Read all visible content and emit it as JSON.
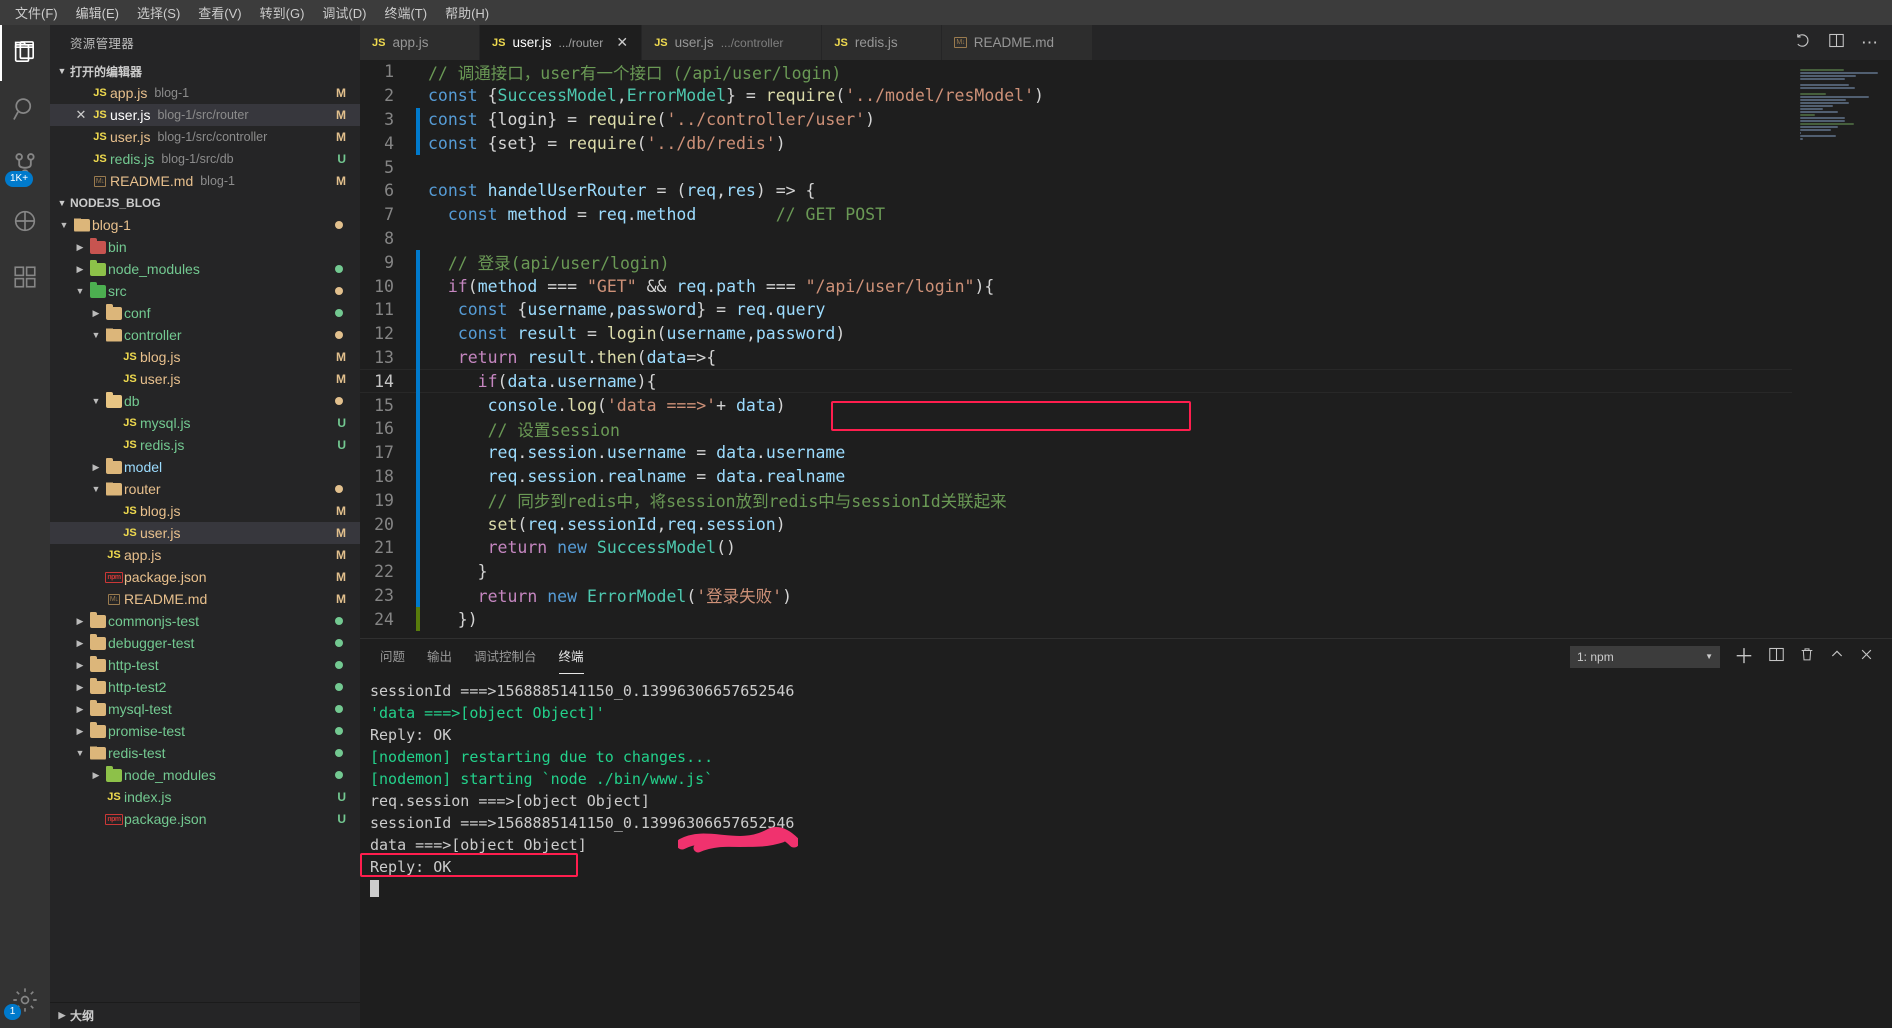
{
  "menubar": {
    "items": [
      "文件(F)",
      "编辑(E)",
      "选择(S)",
      "查看(V)",
      "转到(G)",
      "调试(D)",
      "终端(T)",
      "帮助(H)"
    ]
  },
  "activitybar": {
    "items": [
      {
        "name": "explorer-icon",
        "label": "资源管理器",
        "active": true
      },
      {
        "name": "search-icon",
        "label": "搜索",
        "active": false
      },
      {
        "name": "source-control-icon",
        "label": "源代码管理",
        "active": false,
        "badge": "1K+"
      },
      {
        "name": "debug-icon",
        "label": "调试",
        "active": false
      },
      {
        "name": "extensions-icon",
        "label": "扩展",
        "active": false
      }
    ],
    "bottom": [
      {
        "name": "settings-gear-icon",
        "label": "管理",
        "badge": "1"
      }
    ]
  },
  "sidebar": {
    "title": "资源管理器",
    "open_editors": {
      "label": "打开的编辑器",
      "items": [
        {
          "icon": "js-icon",
          "name": "app.js",
          "desc": "blog-1",
          "status": "M",
          "selected": false,
          "closable": false
        },
        {
          "icon": "js-icon",
          "name": "user.js",
          "desc": "blog-1/src/router",
          "status": "M",
          "selected": true,
          "closable": true
        },
        {
          "icon": "js-icon",
          "name": "user.js",
          "desc": "blog-1/src/controller",
          "status": "M",
          "selected": false,
          "closable": false
        },
        {
          "icon": "js-icon",
          "name": "redis.js",
          "desc": "blog-1/src/db",
          "status": "U",
          "selected": false,
          "closable": false
        },
        {
          "icon": "md-icon",
          "name": "README.md",
          "desc": "blog-1",
          "status": "M",
          "selected": false,
          "closable": false
        }
      ]
    },
    "workspace": {
      "label": "NODEJS_BLOG",
      "items": [
        {
          "indent": 1,
          "twisty": "open",
          "icon": "folder-open-icon",
          "name": "blog-1",
          "color": "peach",
          "status": "dot-m"
        },
        {
          "indent": 2,
          "twisty": "closed",
          "icon": "folder-red-icon",
          "name": "bin",
          "color": "green",
          "status": ""
        },
        {
          "indent": 2,
          "twisty": "closed",
          "icon": "folder-green-icon",
          "name": "node_modules",
          "color": "green",
          "status": "dot-u"
        },
        {
          "indent": 2,
          "twisty": "open",
          "icon": "folder-src-icon",
          "name": "src",
          "color": "green",
          "status": "dot-m"
        },
        {
          "indent": 3,
          "twisty": "closed",
          "icon": "folder-icon",
          "name": "conf",
          "color": "green",
          "status": "dot-u"
        },
        {
          "indent": 3,
          "twisty": "open",
          "icon": "folder-open-icon",
          "name": "controller",
          "color": "green",
          "status": "dot-m"
        },
        {
          "indent": 4,
          "twisty": "none",
          "icon": "js-icon",
          "name": "blog.js",
          "color": "peach",
          "status": "M"
        },
        {
          "indent": 4,
          "twisty": "none",
          "icon": "js-icon",
          "name": "user.js",
          "color": "peach",
          "status": "M"
        },
        {
          "indent": 3,
          "twisty": "open",
          "icon": "folder-db-icon",
          "name": "db",
          "color": "green",
          "status": "dot-m"
        },
        {
          "indent": 4,
          "twisty": "none",
          "icon": "js-icon",
          "name": "mysql.js",
          "color": "green",
          "status": "U"
        },
        {
          "indent": 4,
          "twisty": "none",
          "icon": "js-icon",
          "name": "redis.js",
          "color": "green",
          "status": "U"
        },
        {
          "indent": 3,
          "twisty": "closed",
          "icon": "folder-icon",
          "name": "model",
          "color": "blue",
          "status": ""
        },
        {
          "indent": 3,
          "twisty": "open",
          "icon": "folder-open-icon",
          "name": "router",
          "color": "peach",
          "status": "dot-m"
        },
        {
          "indent": 4,
          "twisty": "none",
          "icon": "js-icon",
          "name": "blog.js",
          "color": "peach",
          "status": "M"
        },
        {
          "indent": 4,
          "twisty": "none",
          "icon": "js-icon",
          "name": "user.js",
          "color": "peach",
          "status": "M",
          "selected": true
        },
        {
          "indent": 3,
          "twisty": "none",
          "icon": "js-icon",
          "name": "app.js",
          "color": "peach",
          "status": "M"
        },
        {
          "indent": 3,
          "twisty": "none",
          "icon": "npm-icon",
          "name": "package.json",
          "color": "peach",
          "status": "M"
        },
        {
          "indent": 3,
          "twisty": "none",
          "icon": "md-icon",
          "name": "README.md",
          "color": "peach",
          "status": "M"
        },
        {
          "indent": 2,
          "twisty": "closed",
          "icon": "folder-icon",
          "name": "commonjs-test",
          "color": "green",
          "status": "dot-u"
        },
        {
          "indent": 2,
          "twisty": "closed",
          "icon": "folder-icon",
          "name": "debugger-test",
          "color": "green",
          "status": "dot-u"
        },
        {
          "indent": 2,
          "twisty": "closed",
          "icon": "folder-icon",
          "name": "http-test",
          "color": "green",
          "status": "dot-u"
        },
        {
          "indent": 2,
          "twisty": "closed",
          "icon": "folder-icon",
          "name": "http-test2",
          "color": "green",
          "status": "dot-u"
        },
        {
          "indent": 2,
          "twisty": "closed",
          "icon": "folder-icon",
          "name": "mysql-test",
          "color": "green",
          "status": "dot-u"
        },
        {
          "indent": 2,
          "twisty": "closed",
          "icon": "folder-icon",
          "name": "promise-test",
          "color": "green",
          "status": "dot-u"
        },
        {
          "indent": 2,
          "twisty": "open",
          "icon": "folder-open-icon",
          "name": "redis-test",
          "color": "green",
          "status": "dot-u"
        },
        {
          "indent": 3,
          "twisty": "closed",
          "icon": "folder-green-icon",
          "name": "node_modules",
          "color": "green",
          "status": "dot-u"
        },
        {
          "indent": 3,
          "twisty": "none",
          "icon": "js-icon",
          "name": "index.js",
          "color": "green",
          "status": "U"
        },
        {
          "indent": 3,
          "twisty": "none",
          "icon": "npm-icon",
          "name": "package.json",
          "color": "green",
          "status": "U"
        }
      ]
    },
    "outline_label": "大纲"
  },
  "tabs": [
    {
      "icon": "js-icon",
      "name": "app.js",
      "desc": "",
      "active": false,
      "closable": false
    },
    {
      "icon": "js-icon",
      "name": "user.js",
      "desc": ".../router",
      "active": true,
      "closable": true
    },
    {
      "icon": "js-icon",
      "name": "user.js",
      "desc": ".../controller",
      "active": false,
      "closable": false
    },
    {
      "icon": "js-icon",
      "name": "redis.js",
      "desc": "",
      "active": false,
      "closable": false
    },
    {
      "icon": "md-icon",
      "name": "README.md",
      "desc": "",
      "active": false,
      "closable": false
    }
  ],
  "tabbar_actions": [
    {
      "name": "split-editor-right-icon"
    },
    {
      "name": "more-actions-icon"
    },
    {
      "name": "run-icon"
    }
  ],
  "editor": {
    "first_line": 1,
    "lines": [
      {
        "n": 1,
        "mark": "",
        "text": "// 调通接口，user有一个接口 (/api/user/login)"
      },
      {
        "n": 2,
        "mark": "",
        "text": "const {SuccessModel,ErrorModel} = require('../model/resModel')"
      },
      {
        "n": 3,
        "mark": "blue",
        "text": "const {login} = require('../controller/user')"
      },
      {
        "n": 4,
        "mark": "blue",
        "text": "const {set} = require('../db/redis')"
      },
      {
        "n": 5,
        "mark": "",
        "text": ""
      },
      {
        "n": 6,
        "mark": "",
        "text": "const handelUserRouter = (req,res) => {"
      },
      {
        "n": 7,
        "mark": "",
        "text": "  const method = req.method        // GET POST"
      },
      {
        "n": 8,
        "mark": "",
        "text": ""
      },
      {
        "n": 9,
        "mark": "blue",
        "text": "  // 登录(api/user/login)"
      },
      {
        "n": 10,
        "mark": "blue",
        "text": "  if(method === \"GET\" && req.path === \"/api/user/login\"){"
      },
      {
        "n": 11,
        "mark": "blue",
        "text": "   const {username,password} = req.query"
      },
      {
        "n": 12,
        "mark": "blue",
        "text": "   const result = login(username,password)"
      },
      {
        "n": 13,
        "mark": "blue",
        "text": "   return result.then(data=>{"
      },
      {
        "n": 14,
        "mark": "blue",
        "text": "     if(data.username){"
      },
      {
        "n": 15,
        "mark": "blue",
        "text": "      console.log('data ===>'+ data)"
      },
      {
        "n": 16,
        "mark": "blue",
        "text": "      // 设置session"
      },
      {
        "n": 17,
        "mark": "blue",
        "text": "      req.session.username = data.username"
      },
      {
        "n": 18,
        "mark": "blue",
        "text": "      req.session.realname = data.realname"
      },
      {
        "n": 19,
        "mark": "blue",
        "text": "      // 同步到redis中，将session放到redis中与sessionId关联起来"
      },
      {
        "n": 20,
        "mark": "blue",
        "text": "      set(req.sessionId,req.session)"
      },
      {
        "n": 21,
        "mark": "blue",
        "text": "      return new SuccessModel()"
      },
      {
        "n": 22,
        "mark": "blue",
        "text": "     }"
      },
      {
        "n": 23,
        "mark": "blue",
        "text": "     return new ErrorModel('登录失败')"
      },
      {
        "n": 24,
        "mark": "green",
        "text": "   })"
      }
    ],
    "cursor_line": 14,
    "highlight_box_line": 15
  },
  "panel": {
    "tabs": [
      {
        "label": "问题",
        "active": false
      },
      {
        "label": "输出",
        "active": false
      },
      {
        "label": "调试控制台",
        "active": false
      },
      {
        "label": "终端",
        "active": true
      }
    ],
    "terminal_select": "1: npm",
    "actions": [
      {
        "name": "new-terminal-icon",
        "glyph": "+"
      },
      {
        "name": "split-terminal-icon",
        "glyph": "▯"
      },
      {
        "name": "kill-terminal-icon",
        "glyph": "🗑"
      },
      {
        "name": "maximize-panel-icon",
        "glyph": "^"
      },
      {
        "name": "close-panel-icon",
        "glyph": "✕"
      }
    ],
    "terminal_lines": [
      {
        "text": "sessionId ===>1568885141150_0.13996306657652546",
        "color": "white"
      },
      {
        "text": "'data ===>[object Object]'",
        "color": "green"
      },
      {
        "text": "Reply: OK",
        "color": "white"
      },
      {
        "text": "[nodemon] restarting due to changes...",
        "color": "green"
      },
      {
        "text": "[nodemon] starting `node ./bin/www.js`",
        "color": "green"
      },
      {
        "text": "req.session ===>[object Object]",
        "color": "white"
      },
      {
        "text": "sessionId ===>1568885141150_0.13996306657652546",
        "color": "white"
      },
      {
        "text": "data ===>[object Object]",
        "color": "white",
        "boxed": true
      },
      {
        "text": "Reply: OK",
        "color": "white"
      },
      {
        "text": "",
        "color": "white",
        "cursor": true
      }
    ]
  },
  "colors": {
    "accent": "#007acc",
    "annotation_red": "#ff1e4e",
    "scribble_pink": "#f0326e",
    "modified": "#e2c08d",
    "untracked": "#73c991"
  }
}
